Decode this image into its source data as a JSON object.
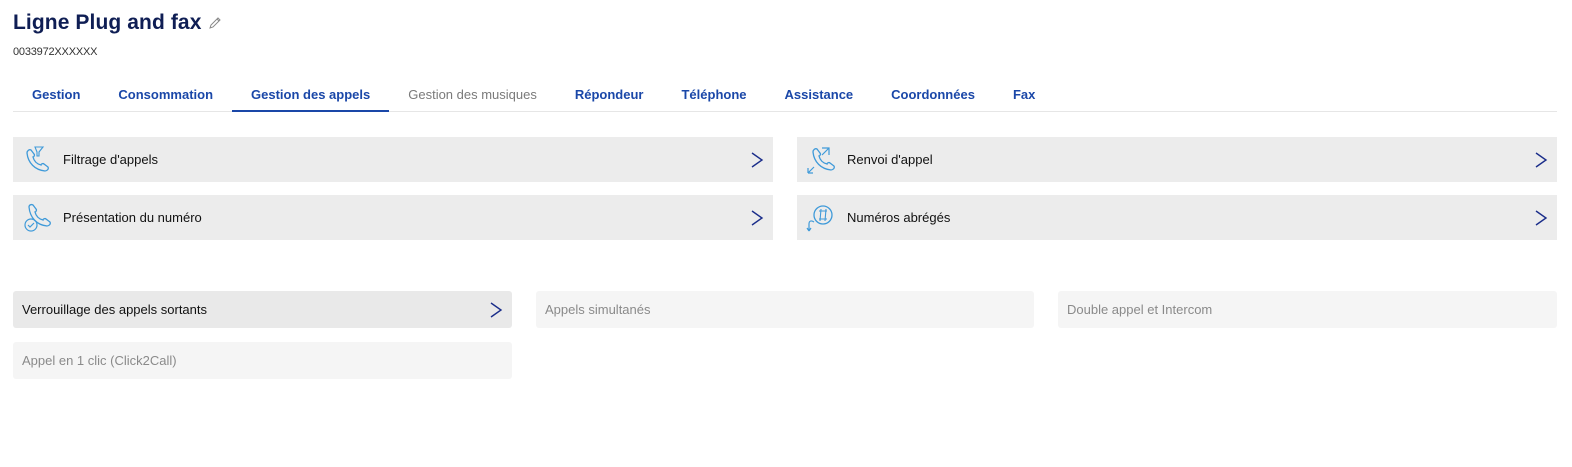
{
  "header": {
    "title": "Ligne Plug and fax",
    "phone": "0033972XXXXXX"
  },
  "tabs": [
    {
      "label": "Gestion",
      "state": "normal"
    },
    {
      "label": "Consommation",
      "state": "normal"
    },
    {
      "label": "Gestion des appels",
      "state": "active"
    },
    {
      "label": "Gestion des musiques",
      "state": "disabled"
    },
    {
      "label": "Répondeur",
      "state": "normal"
    },
    {
      "label": "Téléphone",
      "state": "normal"
    },
    {
      "label": "Assistance",
      "state": "normal"
    },
    {
      "label": "Coordonnées",
      "state": "normal"
    },
    {
      "label": "Fax",
      "state": "normal"
    }
  ],
  "cards": [
    {
      "label": "Filtrage d'appels",
      "icon": "call-filter-icon"
    },
    {
      "label": "Renvoi d'appel",
      "icon": "call-forward-icon"
    },
    {
      "label": "Présentation du numéro",
      "icon": "caller-id-icon"
    },
    {
      "label": "Numéros abrégés",
      "icon": "speed-dial-icon"
    }
  ],
  "tiles": [
    {
      "label": "Verrouillage des appels sortants",
      "enabled": true
    },
    {
      "label": "Appels simultanés",
      "enabled": false
    },
    {
      "label": "Double appel et Intercom",
      "enabled": false
    },
    {
      "label": "Appel en 1 clic (Click2Call)",
      "enabled": false
    }
  ],
  "colors": {
    "title": "#0f1e54",
    "accent": "#1a47a8",
    "icon": "#3f9ad9",
    "card_bg": "#ececec"
  }
}
